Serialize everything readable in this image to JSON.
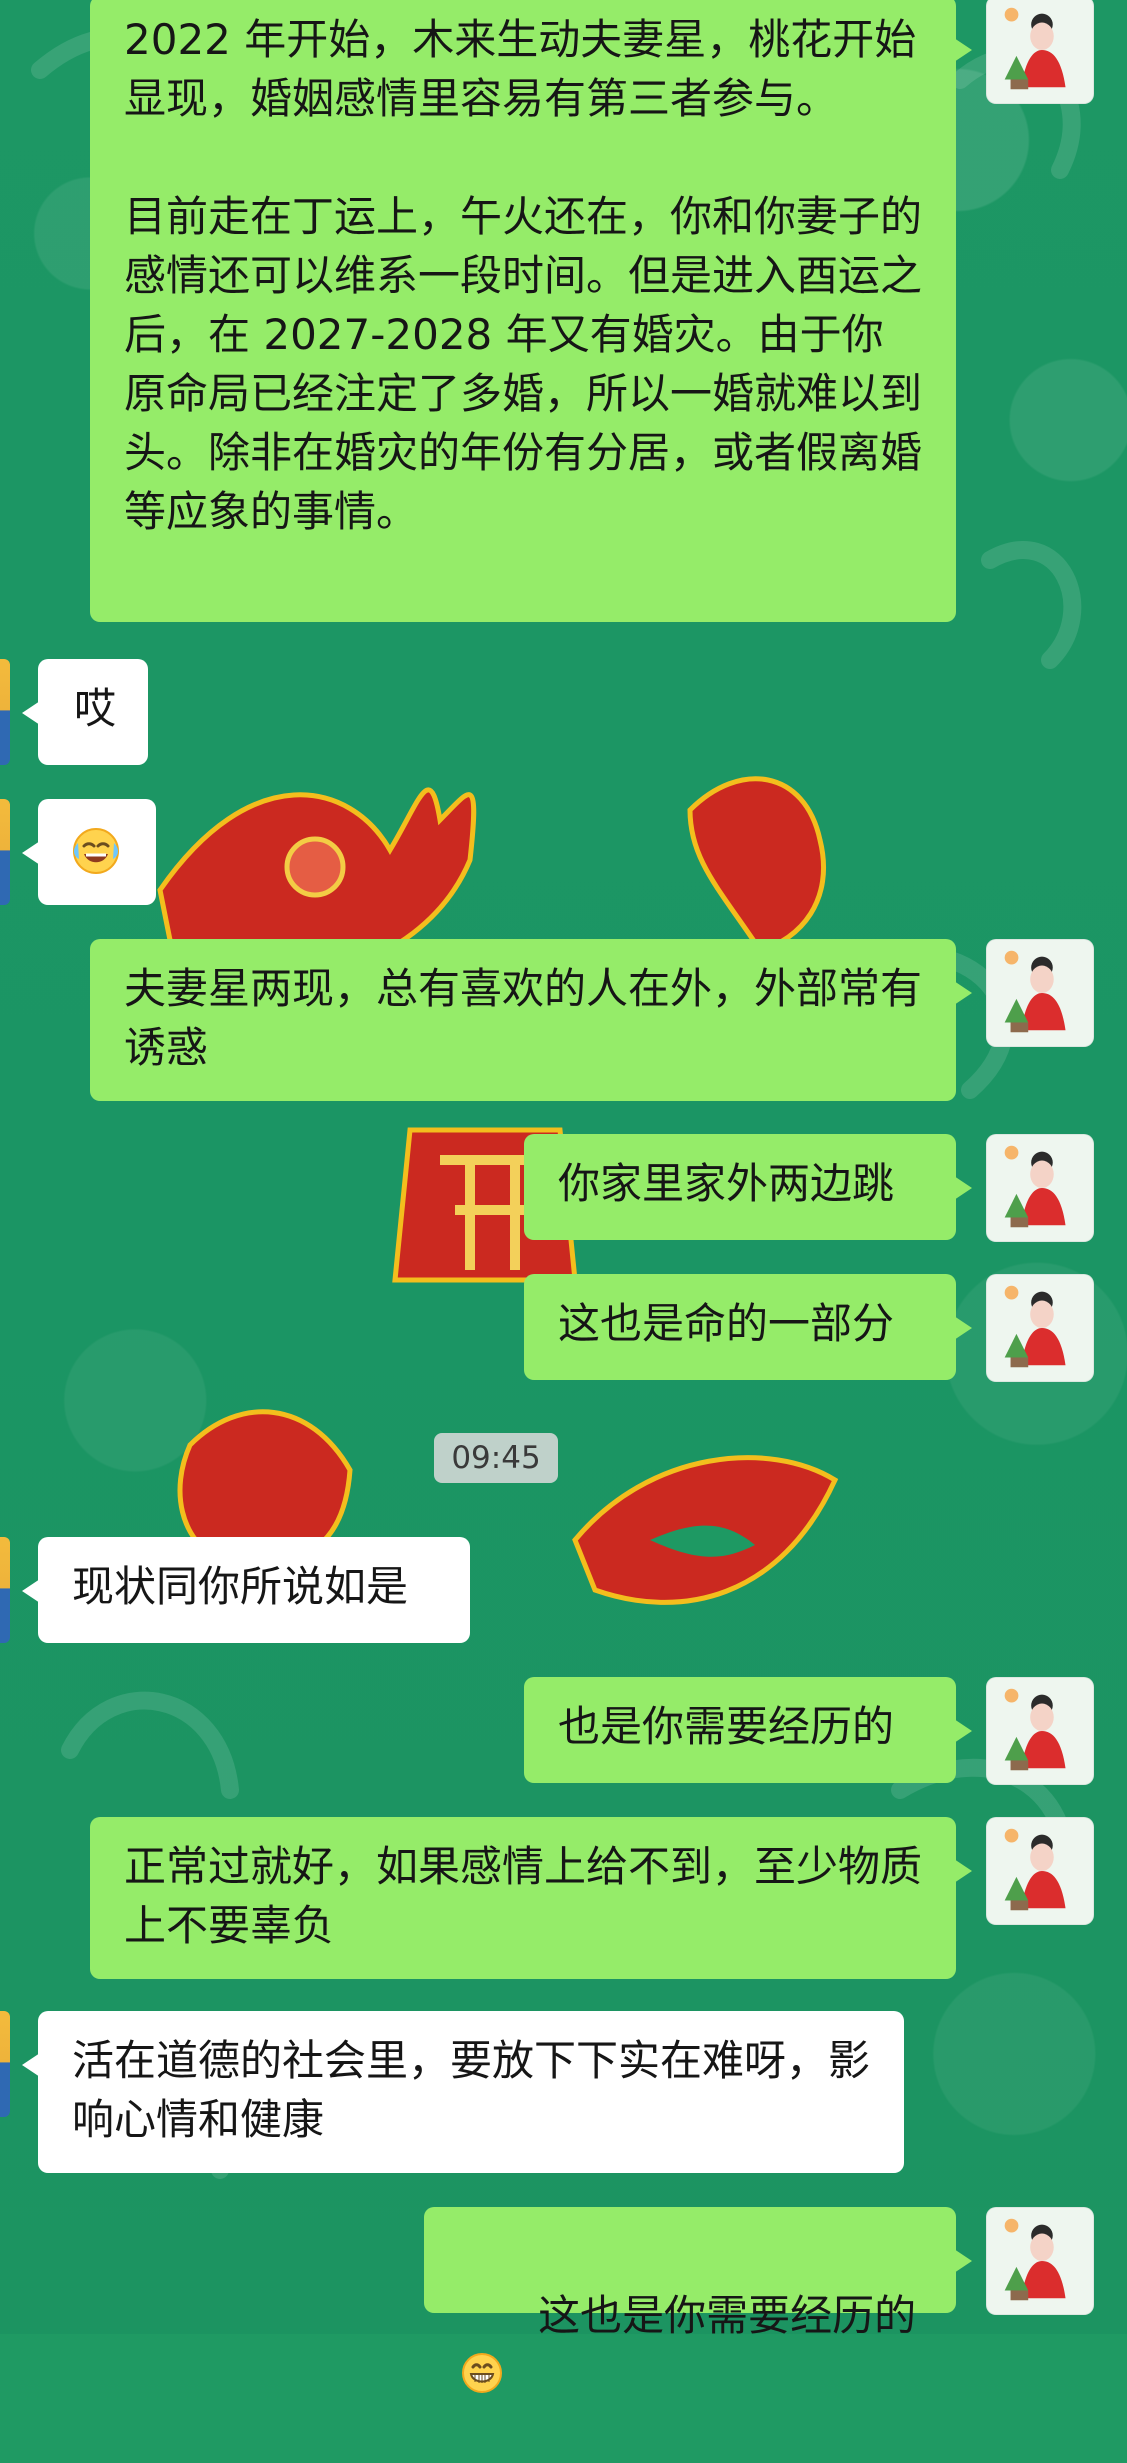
{
  "chat": {
    "timestamp": "09:45",
    "messages": [
      {
        "side": "out",
        "text": "2022 年开始，木来生动夫妻星，桃花开始显现，婚姻感情里容易有第三者参与。\n\n目前走在丁运上，午火还在，你和你妻子的感情还可以维系一段时间。但是进入酉运之后，在 2027-2028 年又有婚灾。由于你原命局已经注定了多婚，所以一婚就难以到头。除非在婚灾的年份有分居，或者假离婚等应象的事情。"
      },
      {
        "side": "in",
        "text": "哎"
      },
      {
        "side": "in",
        "emoji": "crying-laughing-emoji"
      },
      {
        "side": "out",
        "text": "夫妻星两现，总有喜欢的人在外，外部常有诱惑"
      },
      {
        "side": "out",
        "text": "你家里家外两边跳"
      },
      {
        "side": "out",
        "text": "这也是命的一部分"
      },
      {
        "side": "in",
        "text": "现状同你所说如是"
      },
      {
        "side": "out",
        "text": "也是你需要经历的"
      },
      {
        "side": "out",
        "text": "正常过就好，如果感情上给不到，至少物质上不要辜负"
      },
      {
        "side": "in",
        "text": "活在道德的社会里，要放下下实在难呀，影响心情和健康"
      },
      {
        "side": "out",
        "text": "这也是你需要经历的",
        "emoji": "grinning-emoji"
      }
    ]
  },
  "colors": {
    "background": "#1f9a63",
    "outgoing_bubble": "#95ec69",
    "incoming_bubble": "#ffffff",
    "text": "#161616",
    "decor_red": "#d5241d"
  },
  "icons": {
    "avatar": "user-avatar-icon",
    "emoji_crying": "crying-laughing-emoji",
    "emoji_grinning": "grinning-emoji"
  }
}
